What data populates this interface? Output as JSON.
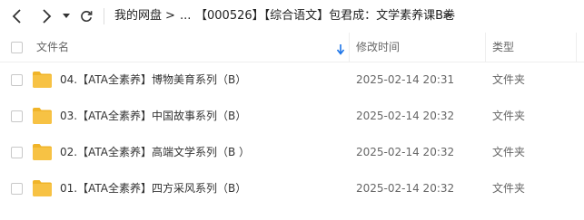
{
  "nav": {
    "back_icon": "chevron-left-icon",
    "forward_icon": "chevron-right-icon",
    "history_icon": "caret-down-icon",
    "refresh_icon": "refresh-icon"
  },
  "breadcrumb": {
    "items": [
      "我的网盘",
      "...",
      "【000526】【综合语文】包君成：文学素养课B卷"
    ],
    "separator": ">"
  },
  "columns": {
    "name": "文件名",
    "modified": "修改时间",
    "type": "类型",
    "sort_icon": "arrow-down-icon"
  },
  "rows": [
    {
      "name": "04.【ATA全素养】博物美育系列（B）",
      "modified": "2025-02-14 20:31",
      "type": "文件夹",
      "icon": "folder-icon"
    },
    {
      "name": "03.【ATA全素养】中国故事系列（B）",
      "modified": "2025-02-14 20:32",
      "type": "文件夹",
      "icon": "folder-icon"
    },
    {
      "name": "02.【ATA全素养】高端文学系列（B ）",
      "modified": "2025-02-14 20:32",
      "type": "文件夹",
      "icon": "folder-icon"
    },
    {
      "name": "01.【ATA全素养】四方采风系列（B）",
      "modified": "2025-02-14 20:32",
      "type": "文件夹",
      "icon": "folder-icon"
    }
  ],
  "colors": {
    "folder": "#f7c244",
    "folder_tab": "#f0b429",
    "sort_arrow": "#1a73e8"
  }
}
